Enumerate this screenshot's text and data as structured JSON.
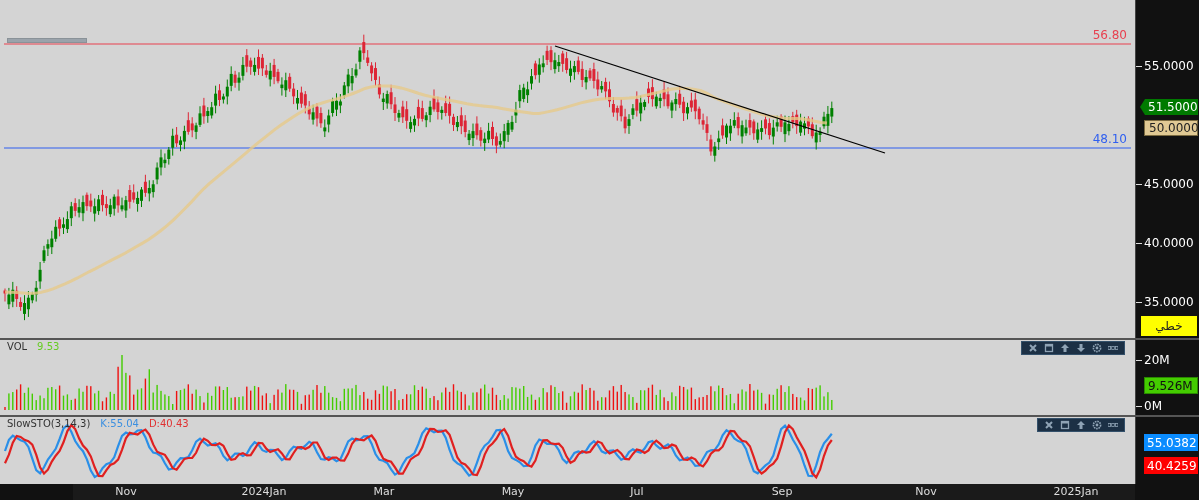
{
  "price_panel": {
    "levels": [
      {
        "label": "56.80",
        "color": "#e8404f"
      },
      {
        "label": "48.10",
        "color": "#2f5ff0"
      }
    ],
    "axis_labels": [
      "55.0000",
      "45.0000",
      "40.0000",
      "35.0000"
    ],
    "price_tags": [
      {
        "label": "51.5000",
        "kind": "last"
      },
      {
        "label": "50.0000",
        "kind": "average"
      }
    ],
    "chart_type_button": "خطي"
  },
  "volume_panel": {
    "title": "VOL",
    "value": "9.53",
    "axis_labels": [
      "20M",
      "0M"
    ],
    "tag": "9.526M"
  },
  "stochastic_panel": {
    "title": "SlowSTO(3,14,3)",
    "k_label": "K:55.04",
    "d_label": "D:40.43",
    "tags": [
      {
        "label": "55.0382",
        "color": "#0a8cff"
      },
      {
        "label": "40.4259",
        "color": "#ff0000"
      }
    ]
  },
  "time_axis": [
    "Nov",
    "2024Jan",
    "Mar",
    "May",
    "Jul",
    "Sep",
    "Nov",
    "2025Jan"
  ]
}
